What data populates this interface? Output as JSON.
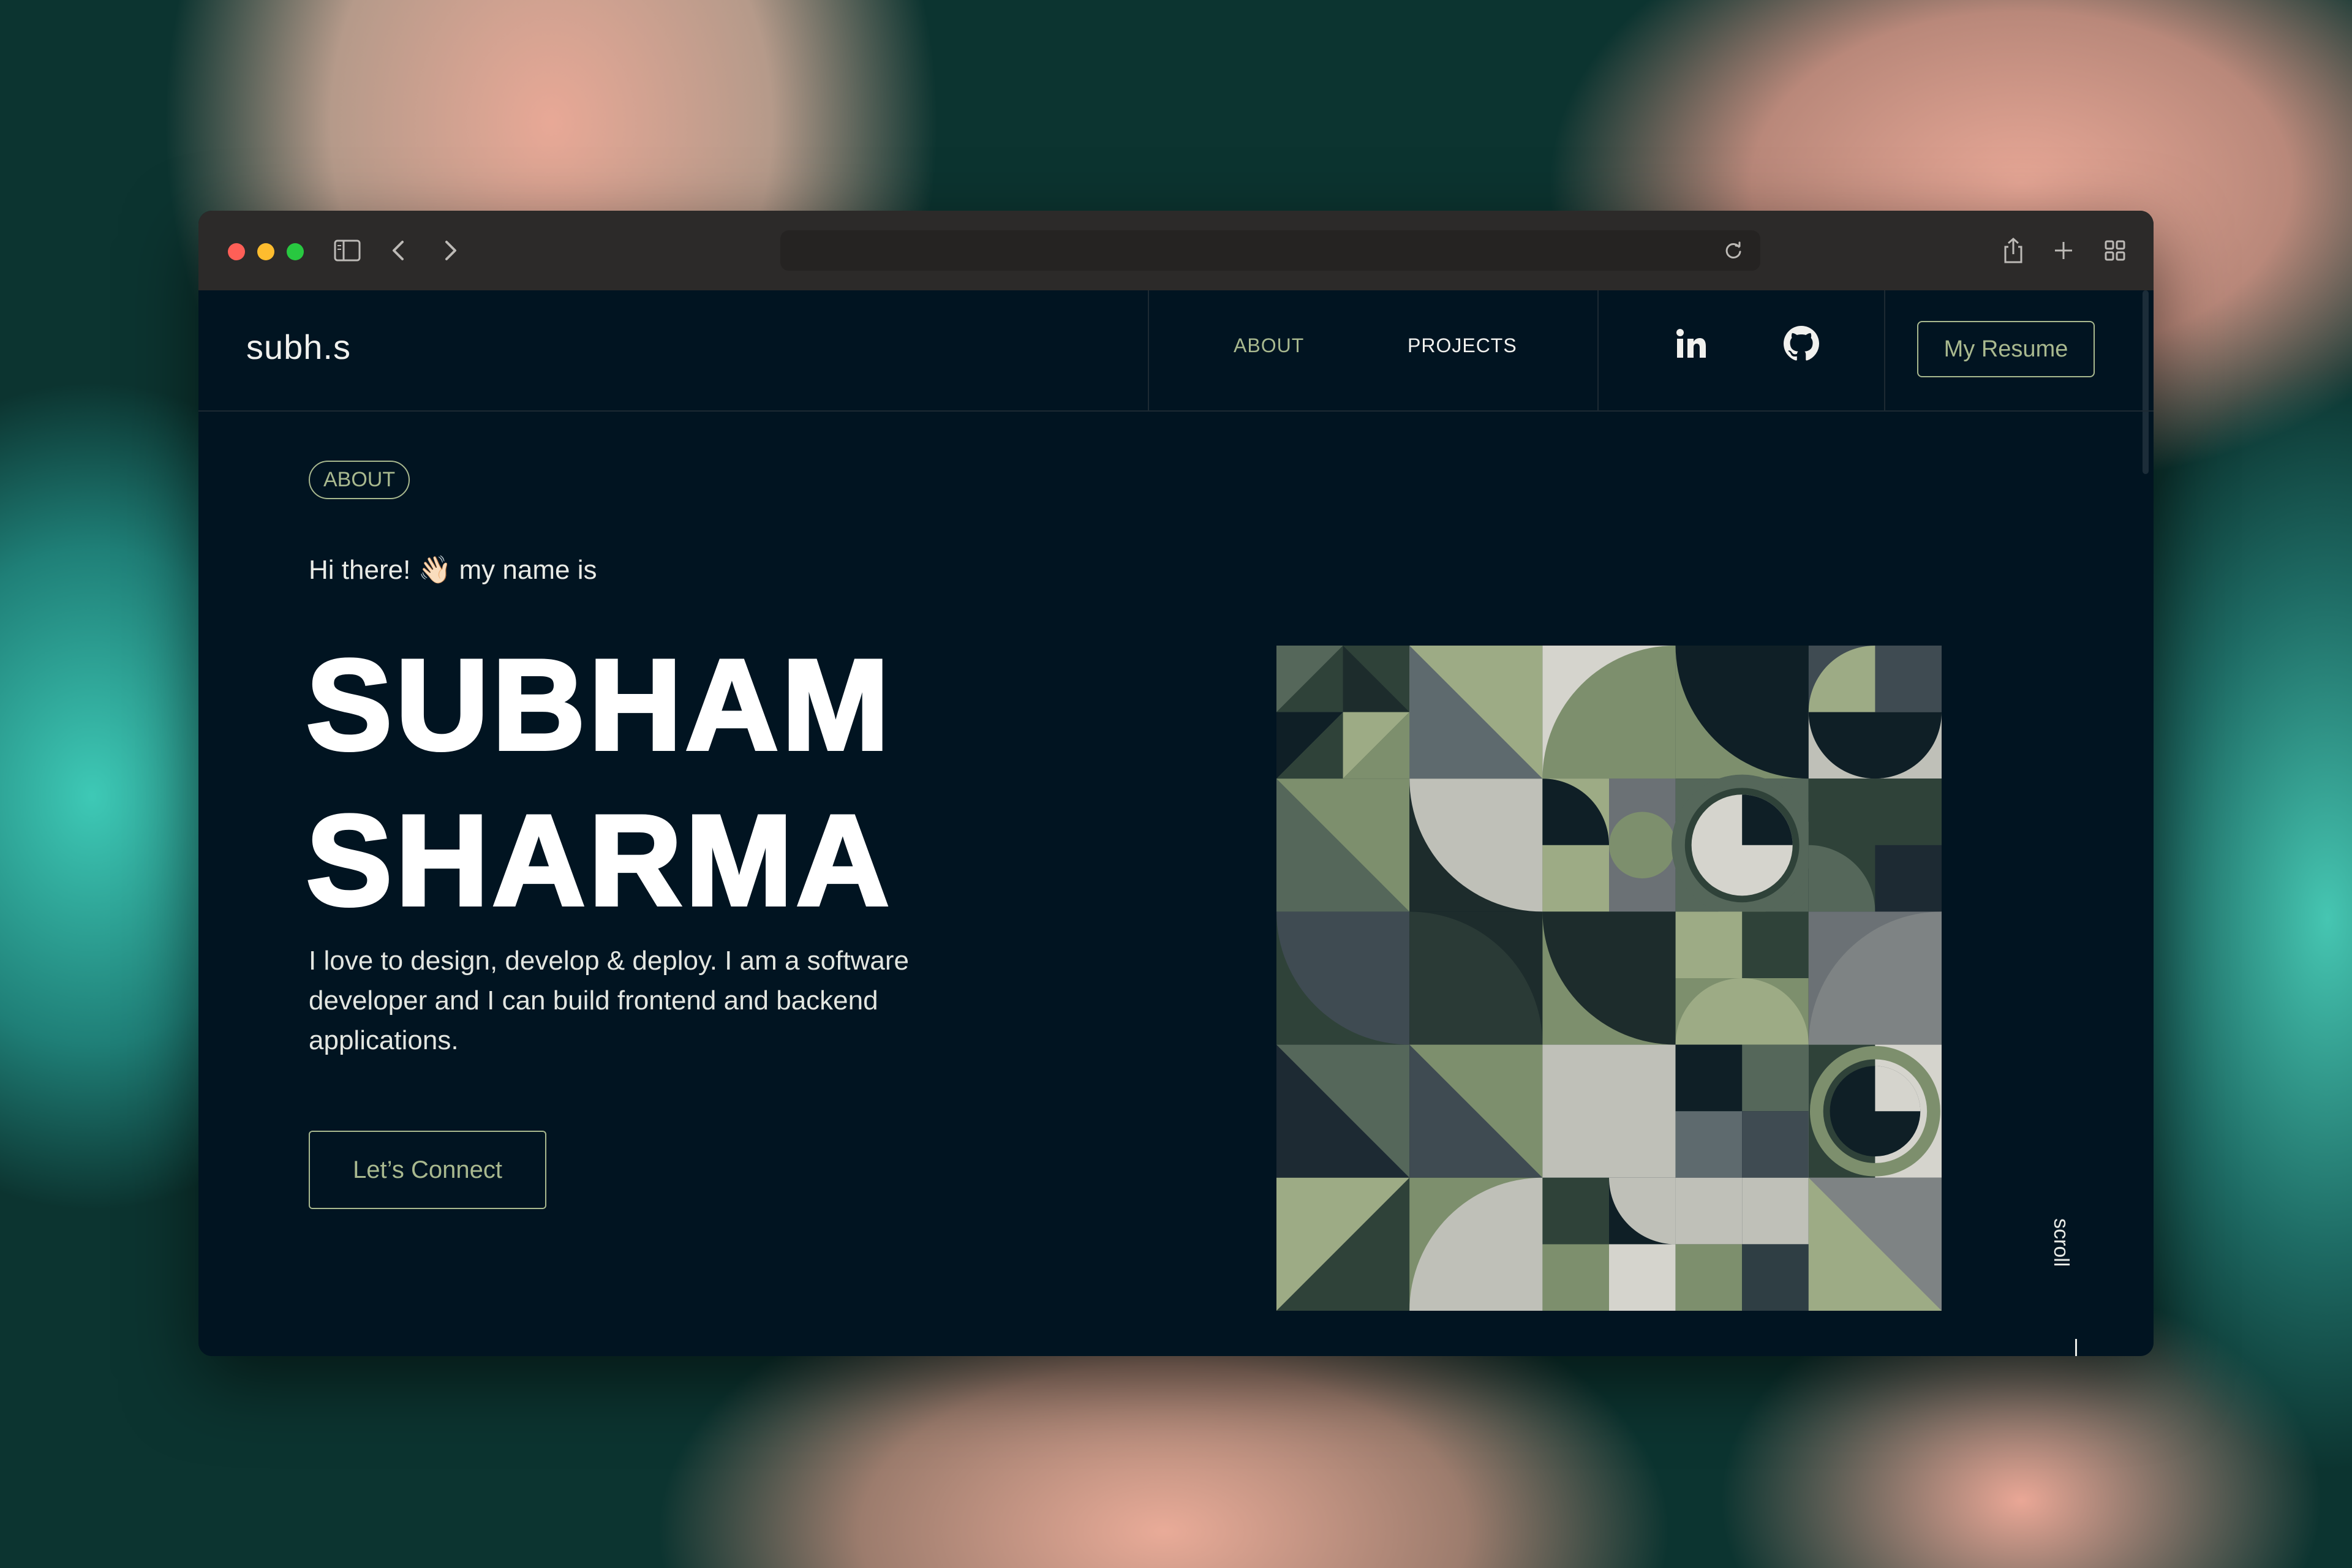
{
  "browser": {
    "url_value": "",
    "icons": [
      "sidebar-icon",
      "back-icon",
      "forward-icon",
      "reload-icon",
      "share-icon",
      "new-tab-icon",
      "tab-overview-icon"
    ]
  },
  "nav": {
    "logo": "subh.s",
    "links": [
      {
        "label": "ABOUT",
        "active": true
      },
      {
        "label": "PROJECTS",
        "active": false
      }
    ],
    "social": [
      "linkedin-icon",
      "github-icon"
    ],
    "resume_label": "My Resume"
  },
  "hero": {
    "tag": "ABOUT",
    "greeting": "Hi there! 👋🏻 my name is",
    "name_line1": "SUBHAM",
    "name_line2": "SHARMA",
    "bio": "I love to design, develop & deploy. I am a software developer and I can build frontend and backend applications.",
    "cta": "Let’s Connect",
    "scroll_label": "scroll"
  },
  "colors": {
    "background": "#011421",
    "accent": "#a9b98f",
    "text": "#f1f1ee",
    "art_palette": [
      "#0f1f26",
      "#2f4239",
      "#55675a",
      "#7d8f6d",
      "#9dab85",
      "#bfc0b8",
      "#d5d4cd",
      "#3f4b52",
      "#6b7175"
    ]
  }
}
